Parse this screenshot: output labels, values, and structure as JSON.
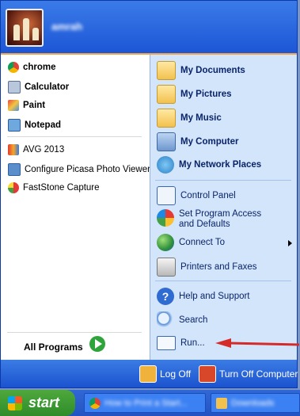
{
  "user": {
    "name": "amrah"
  },
  "pinned": [
    {
      "label": "chrome",
      "icon": "chrome-icon"
    },
    {
      "label": "Calculator",
      "icon": "calculator-icon"
    },
    {
      "label": "Paint",
      "icon": "paint-icon"
    },
    {
      "label": "Notepad",
      "icon": "notepad-icon"
    }
  ],
  "recent": [
    {
      "label": "AVG 2013",
      "icon": "avg-icon"
    },
    {
      "label": "Configure Picasa Photo Viewer",
      "icon": "picasa-icon"
    },
    {
      "label": "FastStone Capture",
      "icon": "faststone-icon"
    }
  ],
  "all_programs": "All Programs",
  "places": [
    {
      "label": "My Documents",
      "icon": "folder-documents-icon"
    },
    {
      "label": "My Pictures",
      "icon": "folder-pictures-icon"
    },
    {
      "label": "My Music",
      "icon": "folder-music-icon"
    },
    {
      "label": "My Computer",
      "icon": "computer-icon"
    },
    {
      "label": "My Network Places",
      "icon": "network-icon"
    }
  ],
  "system": [
    {
      "label": "Control Panel",
      "icon": "control-panel-icon"
    },
    {
      "label": "Set Program Access and Defaults",
      "icon": "program-access-icon"
    },
    {
      "label": "Connect To",
      "icon": "connect-icon"
    },
    {
      "label": "Printers and Faxes",
      "icon": "printer-icon"
    }
  ],
  "help": [
    {
      "label": "Help and Support",
      "icon": "help-icon"
    },
    {
      "label": "Search",
      "icon": "search-icon"
    },
    {
      "label": "Run...",
      "icon": "run-icon"
    }
  ],
  "footer": {
    "logoff": "Log Off",
    "turnoff": "Turn Off Computer"
  },
  "taskbar": {
    "start": "start",
    "tasks": [
      {
        "title": "How to Print a Start...",
        "icon": "chrome-icon"
      },
      {
        "title": "Downloads",
        "icon": "folder-icon"
      }
    ]
  },
  "colors": {
    "annotation_arrow": "#d42a2a"
  }
}
